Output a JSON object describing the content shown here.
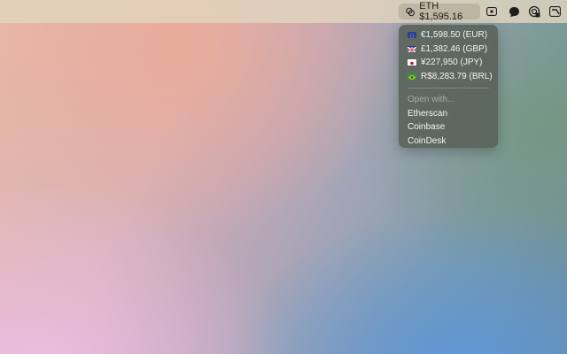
{
  "menubar": {
    "price_label": "ETH $1,595.16"
  },
  "menu": {
    "conversions": [
      {
        "label": "€1,598.50 (EUR)",
        "flag": "eu-flag-icon"
      },
      {
        "label": "£1,382.46 (GBP)",
        "flag": "uk-flag-icon"
      },
      {
        "label": "¥227,950 (JPY)",
        "flag": "jp-flag-icon"
      },
      {
        "label": "R$8,283.79 (BRL)",
        "flag": "br-flag-icon"
      }
    ],
    "open_with_label": "Open with...",
    "links": [
      "Etherscan",
      "Coinbase",
      "CoinDesk"
    ]
  }
}
